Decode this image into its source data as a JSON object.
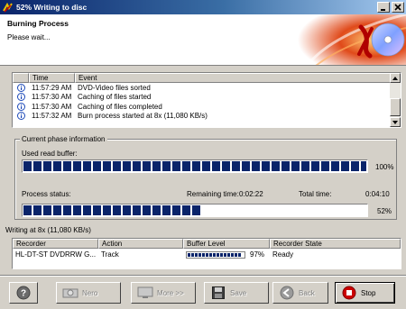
{
  "window": {
    "title": "52% Writing to disc"
  },
  "header": {
    "title": "Burning Process",
    "subtitle": "Please wait..."
  },
  "events": {
    "columns": [
      "",
      "Time",
      "Event"
    ],
    "rows": [
      {
        "icon": "info-icon",
        "time": "11:57:29 AM",
        "event": "DVD-Video files sorted"
      },
      {
        "icon": "info-icon",
        "time": "11:57:30 AM",
        "event": "Caching of files started"
      },
      {
        "icon": "info-icon",
        "time": "11:57:30 AM",
        "event": "Caching of files completed"
      },
      {
        "icon": "info-icon",
        "time": "11:57:32 AM",
        "event": "Burn process started at 8x (11,080 KB/s)"
      }
    ]
  },
  "phase": {
    "legend": "Current phase information",
    "read_buffer_label": "Used read buffer:",
    "read_buffer_percent": "100%",
    "read_buffer_fraction": 1.0,
    "process_status_label": "Process status:",
    "remaining_label": "Remaining time:",
    "remaining_value": "0:02:22",
    "total_label": "Total time:",
    "total_value": "0:04:10",
    "process_percent": "52%",
    "process_fraction": 0.52
  },
  "writing_status": "Writing at 8x (11,080 KB/s)",
  "recorders": {
    "columns": [
      "Recorder",
      "Action",
      "Buffer Level",
      "Recorder State"
    ],
    "rows": [
      {
        "recorder": "HL-DT-ST DVDRRW G...",
        "action": "Track",
        "buffer_percent": "97%",
        "buffer_fraction": 0.97,
        "state": "Ready"
      }
    ]
  },
  "buttons": {
    "help": "",
    "nero": "Nero",
    "more": "More >>",
    "save": "Save",
    "back": "Back",
    "stop": "Stop"
  },
  "colors": {
    "progress": "#0a246a",
    "titlebar": "#0a246a",
    "stop_icon": "#cc0000"
  }
}
